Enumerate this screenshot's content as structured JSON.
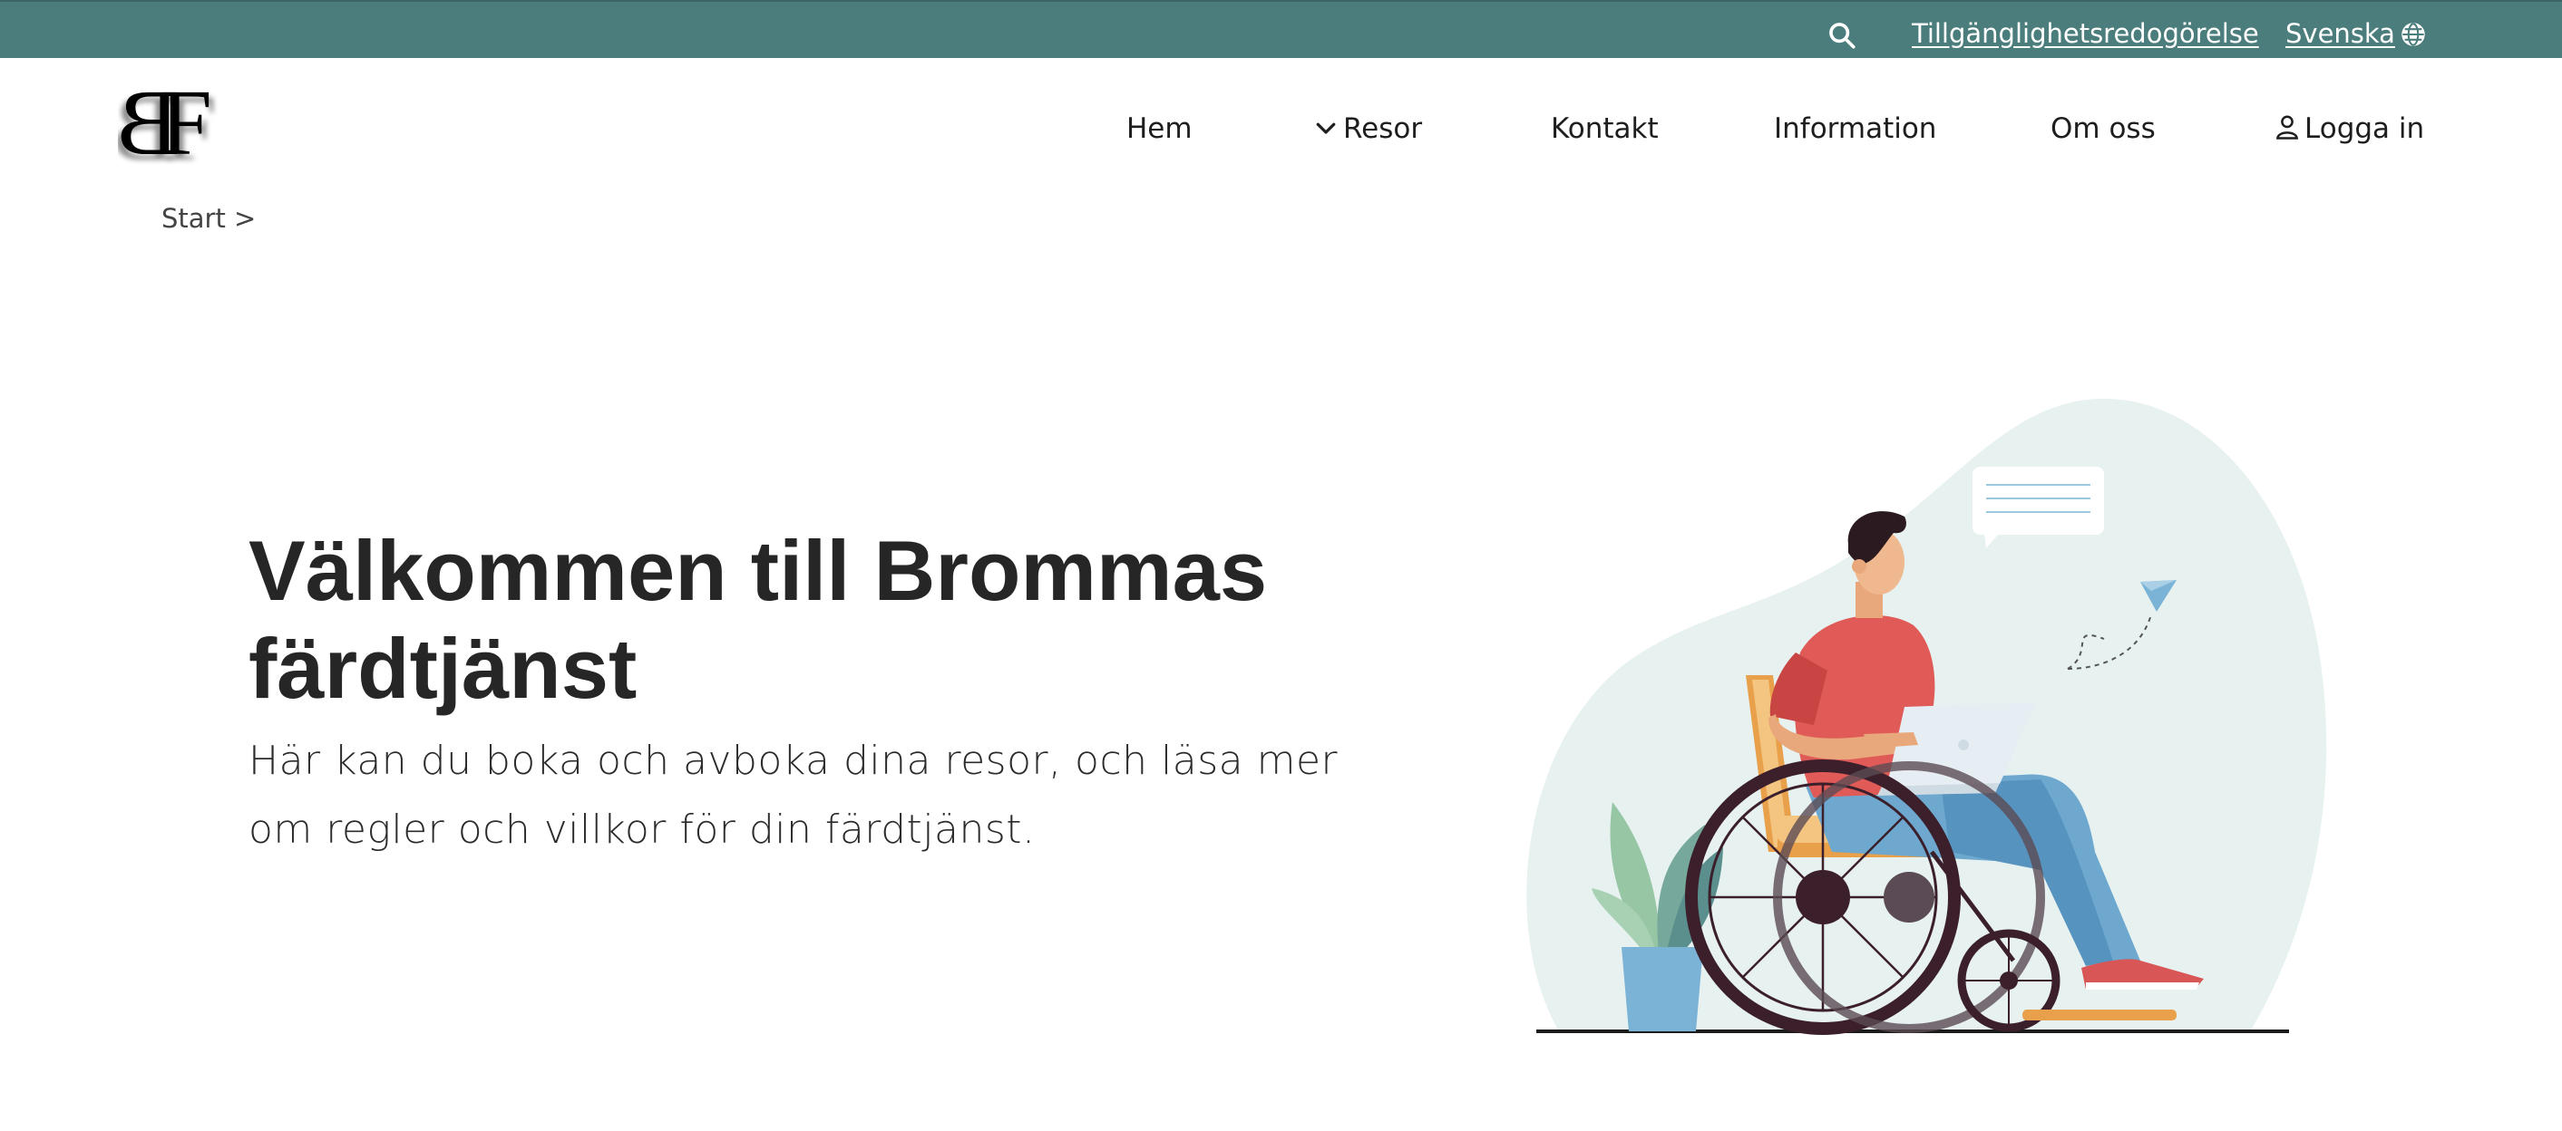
{
  "topbar": {
    "accessibility_link": "Tillgänglighetsredogörelse",
    "language_link": "Svenska",
    "background": "#4a7d7b"
  },
  "logo": {
    "text": "BF"
  },
  "nav": {
    "items": [
      {
        "label": "Hem"
      },
      {
        "label": "Resor"
      },
      {
        "label": "Kontakt"
      },
      {
        "label": "Information"
      },
      {
        "label": "Om oss"
      },
      {
        "label": "Logga in"
      }
    ]
  },
  "breadcrumb": {
    "text": "Start >"
  },
  "hero": {
    "title": "Välkommen till Brommas färdtjänst",
    "text": "Här kan du boka och avboka dina resor, och läsa mer om regler och villkor för din färdtjänst."
  },
  "icons": [
    "search-icon",
    "globe-icon",
    "chevron-down-icon",
    "user-icon"
  ]
}
